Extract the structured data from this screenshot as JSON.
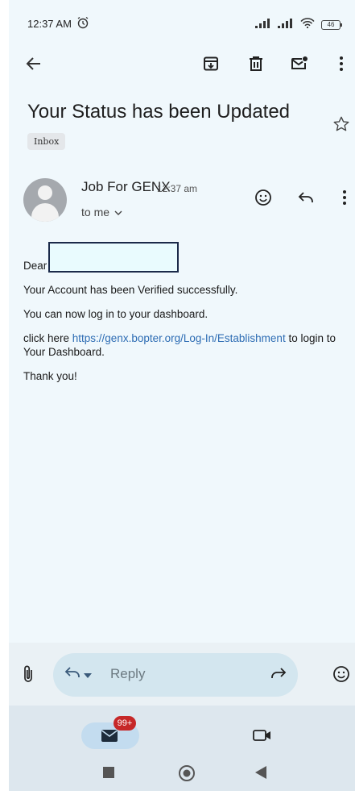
{
  "status_bar": {
    "time": "12:37 AM",
    "battery": "46"
  },
  "toolbar": {
    "back_icon": "arrow-left-icon",
    "archive_icon": "archive-icon",
    "delete_icon": "trash-icon",
    "mark_unread_icon": "mail-unread-icon",
    "more_icon": "more-vert-icon"
  },
  "email": {
    "subject": "Your Status has been Updated",
    "label": "Inbox",
    "sender": "Job For GENX",
    "time": "12:37 am",
    "recipient": "to me",
    "greeting": "Dear",
    "line1": "Your Account has been Verified successfully.",
    "line2": "You can now log in to your dashboard.",
    "link_prefix": "click here ",
    "link_text": "https://genx.bopter.org/Log-In/Establishment",
    "link_suffix": " to login to Your Dashboard.",
    "closing": "Thank you!"
  },
  "reply_bar": {
    "placeholder": "Reply"
  },
  "bottom_nav": {
    "mail_badge": "99+"
  },
  "colors": {
    "background": "#f0f8fc",
    "link": "#2e6db4",
    "badge": "#c62828",
    "reply_pill": "#d3e6ef"
  }
}
